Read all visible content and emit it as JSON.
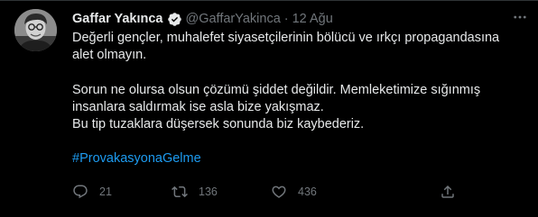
{
  "tweet": {
    "author": {
      "display_name": "Gaffar Yakınca",
      "handle": "@GaffarYakinca",
      "verified": true,
      "avatar_icon": "profile-photo"
    },
    "separator": "·",
    "date": "12 Ağu",
    "text": {
      "paragraph1": "Değerli gençler, muhalefet siyasetçilerinin bölücü ve ırkçı propagandasına alet olmayın.",
      "paragraph2_line1": "Sorun ne olursa olsun çözümü şiddet değildir. Memleketimize sığınmış insanlara saldırmak ise asla bize yakışmaz.",
      "paragraph2_line2": "Bu tip tuzaklara düşersek sonunda biz kaybederiz.",
      "hashtag": "#ProvakasyonaGelme"
    },
    "actions": {
      "reply": {
        "icon": "reply-icon",
        "count": "21"
      },
      "retweet": {
        "icon": "retweet-icon",
        "count": "136"
      },
      "like": {
        "icon": "heart-icon",
        "count": "436"
      },
      "share": {
        "icon": "share-icon"
      }
    },
    "more_icon": "more-options-icon"
  },
  "colors": {
    "background": "#000000",
    "text_primary": "#e7e9ea",
    "text_secondary": "#71767b",
    "link": "#1d9bf0",
    "verified_badge": "#e7e9ea"
  }
}
